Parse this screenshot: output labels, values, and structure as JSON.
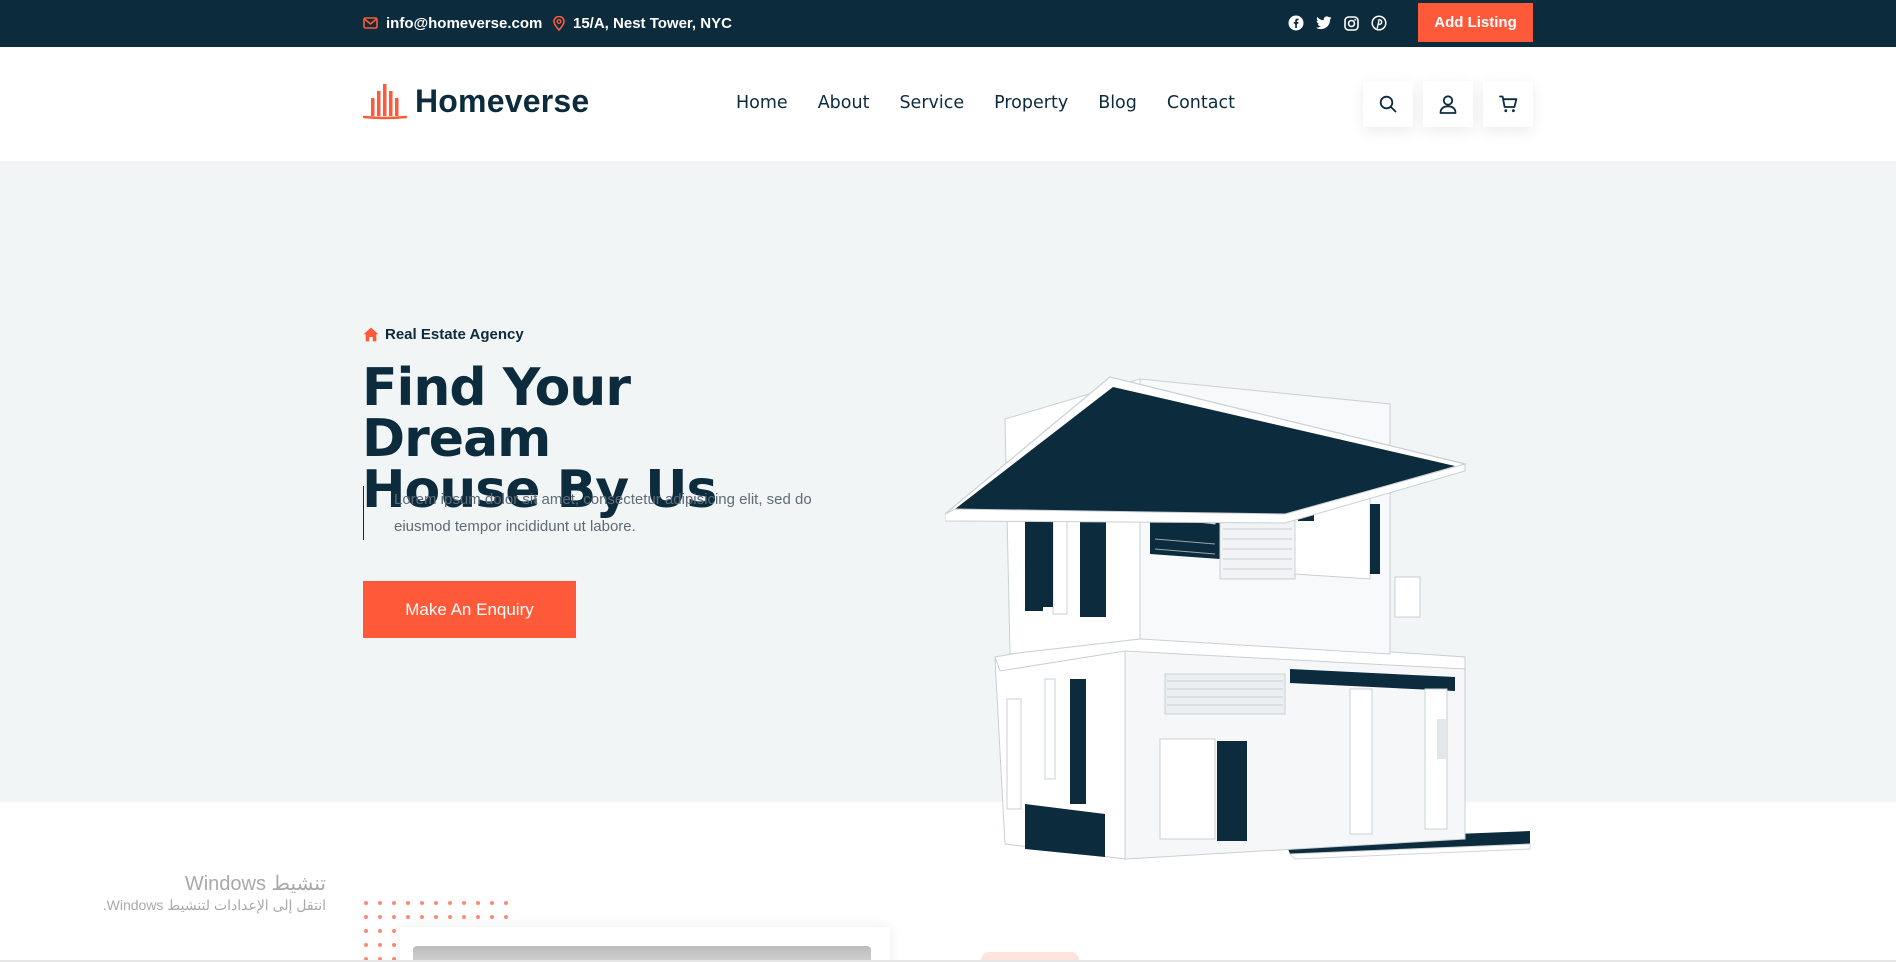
{
  "topbar": {
    "email": "info@homeverse.com",
    "address": "15/A, Nest Tower, NYC",
    "social_icons": [
      "facebook-icon",
      "twitter-icon",
      "instagram-icon",
      "pinterest-icon"
    ],
    "add_listing_label": "Add Listing"
  },
  "header": {
    "logo_text": "Homeverse",
    "nav": [
      "Home",
      "About",
      "Service",
      "Property",
      "Blog",
      "Contact"
    ],
    "action_icons": [
      "search-icon",
      "user-icon",
      "cart-icon"
    ]
  },
  "hero": {
    "subtitle": "Real Estate Agency",
    "title_line1": "Find Your Dream",
    "title_line2": "House By Us",
    "text": "Lorem ipsum dolor sit amet, consectetur adipisicing elit, sed do eiusmod tempor incididunt ut labore.",
    "cta_label": "Make An Enquiry"
  },
  "windows_watermark": {
    "title": "تنشيط Windows",
    "subtitle": "انتقل إلى الإعدادات لتنشيط Windows."
  },
  "colors": {
    "primary_dark": "#0c2b3d",
    "accent": "#fe5a3a",
    "hero_bg": "#f1f5f5"
  }
}
